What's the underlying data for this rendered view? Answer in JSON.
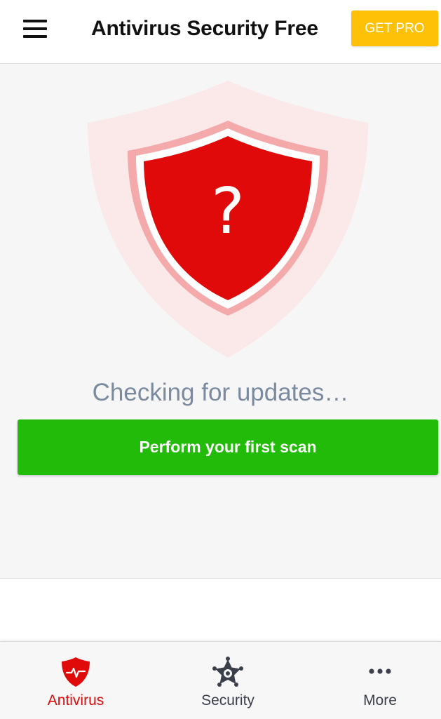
{
  "header": {
    "title": "Antivirus Security Free",
    "get_pro_label": "GET PRO",
    "menu_icon": "hamburger-menu-icon"
  },
  "main": {
    "shield_icon": "shield-question-icon",
    "shield_symbol": "?",
    "status_text": "Checking for updates…",
    "scan_button_label": "Perform your first scan"
  },
  "bottom_nav": {
    "items": [
      {
        "label": "Antivirus",
        "icon": "shield-pulse-icon",
        "active": true
      },
      {
        "label": "Security",
        "icon": "sheriff-badge-icon",
        "active": false
      },
      {
        "label": "More",
        "icon": "more-dots-icon",
        "active": false
      }
    ]
  },
  "colors": {
    "accent_red": "#e00a0a",
    "pro_yellow": "#ffc107",
    "scan_green": "#22bb0a",
    "status_gray": "#7b8a9e",
    "nav_inactive": "#3a3f4a"
  }
}
